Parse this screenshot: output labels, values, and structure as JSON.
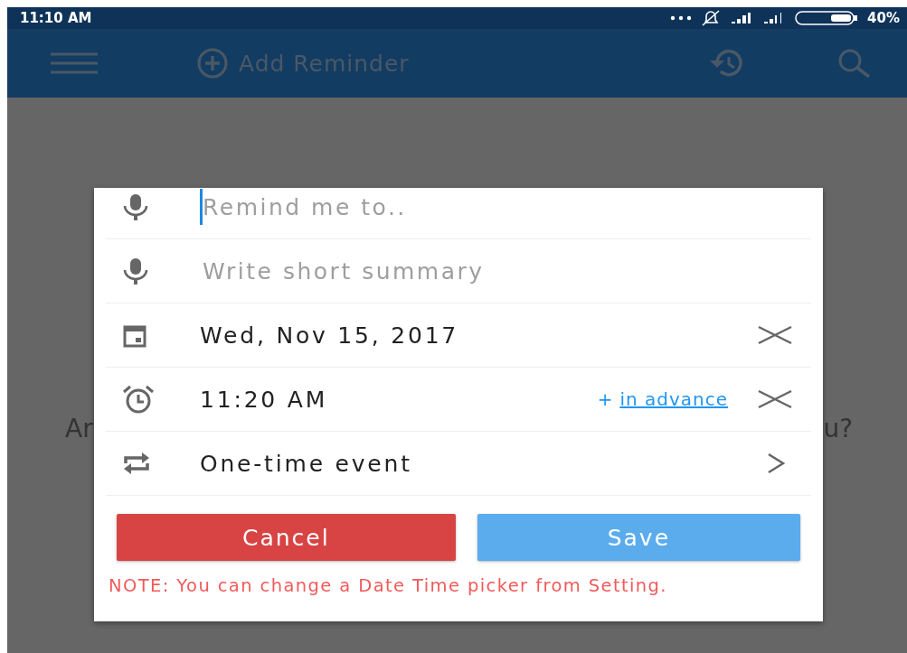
{
  "status_bar": {
    "time": "11:10 AM",
    "battery": "40%"
  },
  "app_bar": {
    "title": "Add Reminder"
  },
  "backdrop": {
    "left_text": "Ar",
    "right_text": "u?"
  },
  "dialog": {
    "fields": [
      {
        "kind": "input",
        "placeholder": "Remind me to..",
        "focused": true
      },
      {
        "kind": "input",
        "placeholder": "Write short summary",
        "focused": false
      }
    ],
    "date": {
      "value": "Wed, Nov 15, 2017"
    },
    "time": {
      "value": "11:20 AM",
      "plus": "+",
      "advance_link": "in advance"
    },
    "repeat": {
      "value": "One-time event"
    },
    "buttons": [
      {
        "kind": "cancel",
        "label": "Cancel"
      },
      {
        "kind": "save",
        "label": "Save"
      }
    ],
    "note": "NOTE: You can change a Date Time picker from Setting."
  }
}
